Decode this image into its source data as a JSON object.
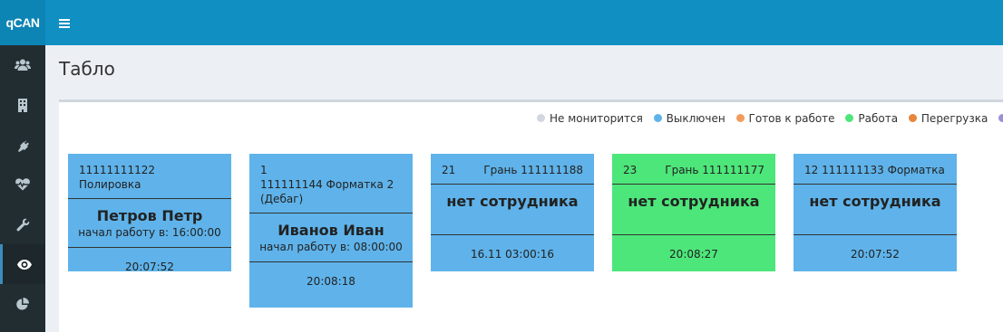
{
  "app": {
    "logo": "qCAN"
  },
  "page": {
    "title": "Табло"
  },
  "sidebar": {
    "items": [
      {
        "icon": "users-icon"
      },
      {
        "icon": "building-icon"
      },
      {
        "icon": "plug-icon"
      },
      {
        "icon": "heartbeat-icon"
      },
      {
        "icon": "wrench-icon"
      },
      {
        "icon": "eye-icon",
        "active": true
      },
      {
        "icon": "pie-chart-icon"
      }
    ]
  },
  "legend": [
    {
      "label": "Не мониторится",
      "color": "#d2d6de"
    },
    {
      "label": "Выключен",
      "color": "#5fb3ea"
    },
    {
      "label": "Готов к работе",
      "color": "#f39c5a"
    },
    {
      "label": "Работа",
      "color": "#4de67a"
    },
    {
      "label": "Перегрузка",
      "color": "#e8843c"
    },
    {
      "label": "",
      "color": "#9b8fd8"
    }
  ],
  "cards": [
    {
      "line1_left": "11111111122 Полировка",
      "line1_right": "",
      "line2": "",
      "line3": "",
      "name": "Петров Петр",
      "started": "начал работу в: 16:00:00",
      "time": "20:07:52",
      "status_color": "#5fb3ea"
    },
    {
      "line1_left": "1",
      "line1_right": "",
      "line2": "111111144 Форматка 2",
      "line3": "(Дебаг)",
      "name": "Иванов Иван",
      "started": "начал работу в: 08:00:00",
      "time": "20:08:18",
      "status_color": "#5fb3ea"
    },
    {
      "line1_left": "21",
      "line1_right": "Грань 111111188",
      "line2": "",
      "line3": "",
      "name": "нет сотрудника",
      "started": "",
      "time": "16.11 03:00:16",
      "status_color": "#5fb3ea"
    },
    {
      "line1_left": "23",
      "line1_right": "Грань 111111177",
      "line2": "",
      "line3": "",
      "name": "нет сотрудника",
      "started": "",
      "time": "20:08:27",
      "status_color": "#4de67a"
    },
    {
      "line1_left": "12  111111133 Форматка",
      "line1_right": "",
      "line2": "",
      "line3": "",
      "name": "нет сотрудника",
      "started": "",
      "time": "20:07:52",
      "status_color": "#5fb3ea"
    }
  ]
}
